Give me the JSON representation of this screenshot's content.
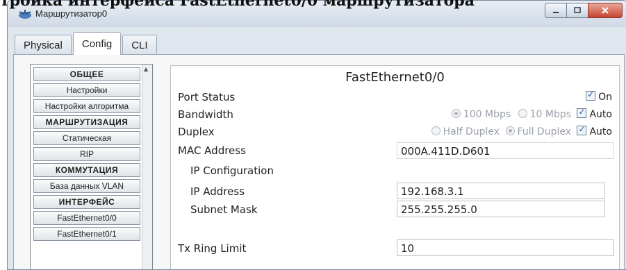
{
  "doc_heading": "тройка интерфейса FastEthernet0/0 маршрутизатора",
  "window": {
    "title": "Маршрутизатор0",
    "icon": "router-icon"
  },
  "tabs": [
    {
      "label": "Physical",
      "active": false
    },
    {
      "label": "Config",
      "active": true
    },
    {
      "label": "CLI",
      "active": false
    }
  ],
  "sidebar": {
    "items": [
      {
        "label": "ОБЩЕЕ",
        "type": "header"
      },
      {
        "label": "Настройки",
        "type": "item"
      },
      {
        "label": "Настройки алгоритма",
        "type": "item"
      },
      {
        "label": "МАРШРУТИЗАЦИЯ",
        "type": "header"
      },
      {
        "label": "Статическая",
        "type": "item"
      },
      {
        "label": "RIP",
        "type": "item"
      },
      {
        "label": "КОММУТАЦИЯ",
        "type": "header"
      },
      {
        "label": "База данных VLAN",
        "type": "item"
      },
      {
        "label": "ИНТЕРФЕЙС",
        "type": "header"
      },
      {
        "label": "FastEthernet0/0",
        "type": "item"
      },
      {
        "label": "FastEthernet0/1",
        "type": "item"
      }
    ]
  },
  "panel": {
    "title": "FastEthernet0/0",
    "port_status": {
      "label": "Port Status",
      "checkbox_label": "On",
      "checked": true
    },
    "bandwidth": {
      "label": "Bandwidth",
      "opt_100": "100 Mbps",
      "opt_10": "10 Mbps",
      "auto_label": "Auto",
      "selected": "100 Mbps",
      "auto_checked": true
    },
    "duplex": {
      "label": "Duplex",
      "opt_half": "Half Duplex",
      "opt_full": "Full Duplex",
      "auto_label": "Auto",
      "selected": "Full Duplex",
      "auto_checked": true
    },
    "mac": {
      "label": "MAC Address",
      "value": "000A.411D.D601"
    },
    "ip_config": {
      "heading": "IP Configuration",
      "ip_label": "IP Address",
      "ip_value": "192.168.3.1",
      "mask_label": "Subnet Mask",
      "mask_value": "255.255.255.0"
    },
    "tx_ring": {
      "label": "Tx Ring Limit",
      "value": "10"
    }
  },
  "colors": {
    "accent": "#2a57a0",
    "close_button": "#c7442f",
    "dim_text": "#9aa0a8"
  }
}
